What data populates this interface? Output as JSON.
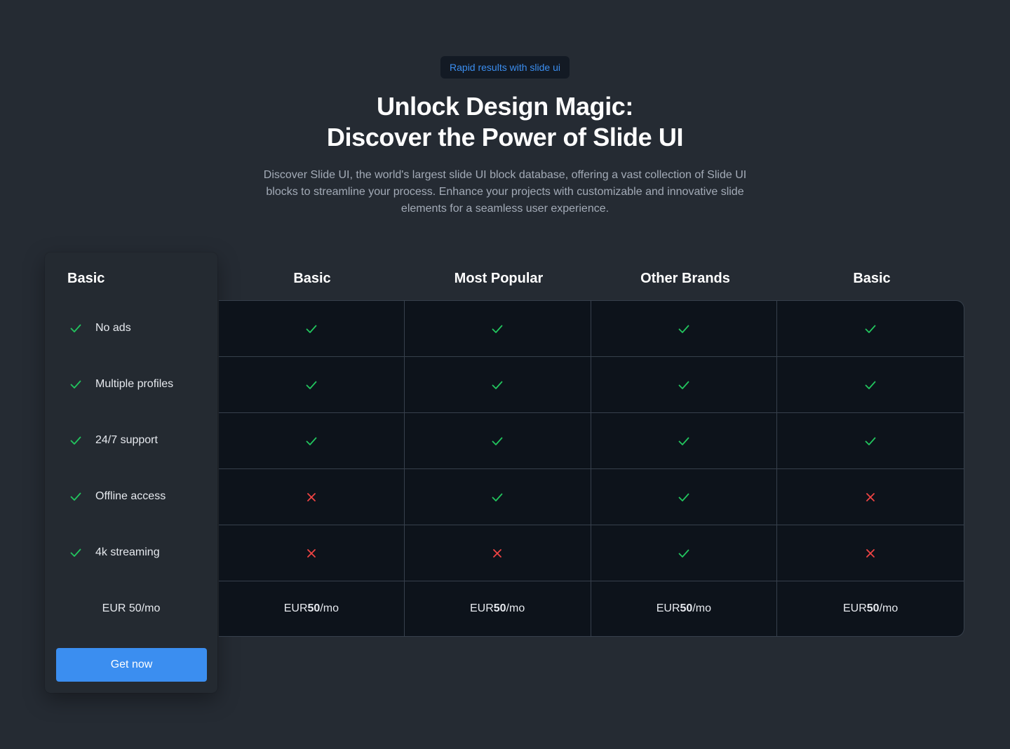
{
  "hero": {
    "badge": "Rapid results with slide ui",
    "title_line1": "Unlock Design Magic:",
    "title_line2": "Discover the Power of Slide UI",
    "description": "Discover Slide UI, the world's largest slide UI block database, offering a vast collection of Slide UI blocks to streamline your process. Enhance your projects with customizable and innovative slide elements for a seamless user experience."
  },
  "plan_card": {
    "title": "Basic",
    "features": [
      {
        "label": "No ads",
        "icon": "check-icon"
      },
      {
        "label": "Multiple profiles",
        "icon": "check-icon"
      },
      {
        "label": "24/7 support",
        "icon": "check-icon"
      },
      {
        "label": "Offline access",
        "icon": "check-icon"
      },
      {
        "label": "4k streaming",
        "icon": "check-icon"
      }
    ],
    "price": "EUR 50/mo",
    "button_label": "Get now"
  },
  "table": {
    "columns": [
      "Basic",
      "Most Popular",
      "Other Brands",
      "Basic"
    ],
    "rows": [
      [
        true,
        true,
        true,
        true
      ],
      [
        true,
        true,
        true,
        true
      ],
      [
        true,
        true,
        true,
        true
      ],
      [
        false,
        true,
        true,
        false
      ],
      [
        false,
        false,
        true,
        false
      ]
    ],
    "price_prefix": "EUR ",
    "price_amount": "50",
    "price_suffix": "/mo"
  },
  "colors": {
    "background": "#252b33",
    "accent": "#3b8ef0",
    "check": "#22c55e",
    "cross": "#ef4444"
  }
}
